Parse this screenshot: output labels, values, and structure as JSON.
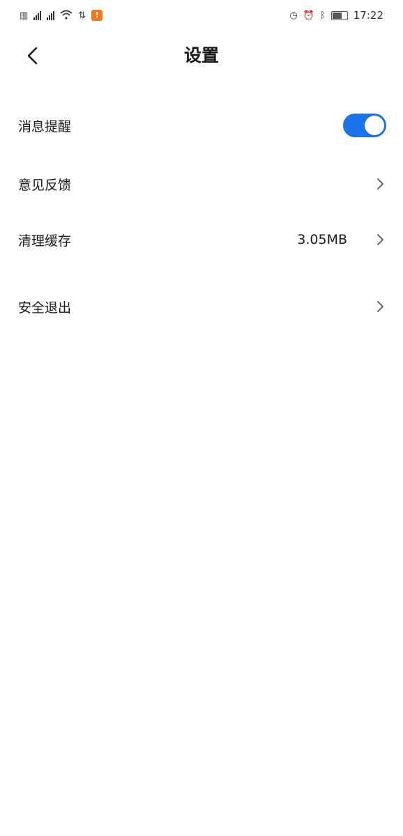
{
  "status_bar": {
    "time": "17:22",
    "notification_badge": "!",
    "accent_color": "#f07a1a"
  },
  "nav": {
    "title": "设置",
    "back_icon": "chevron-left-icon"
  },
  "settings": {
    "items": [
      {
        "label": "消息提醒",
        "type": "toggle",
        "on": true
      },
      {
        "label": "意见反馈",
        "type": "link"
      },
      {
        "label": "清理缓存",
        "type": "link",
        "value": "3.05MB"
      },
      {
        "label": "安全退出",
        "type": "link"
      }
    ]
  },
  "colors": {
    "toggle_on": "#1a73e8",
    "background": "#ffffff",
    "text": "#1a1a1a"
  }
}
